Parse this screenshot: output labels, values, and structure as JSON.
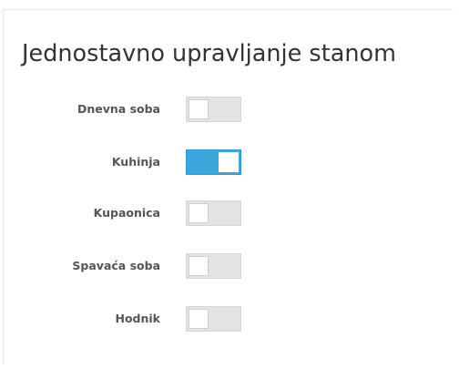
{
  "page": {
    "title": "Jednostavno upravljanje stanom"
  },
  "colors": {
    "toggle_on": "#3aa8dc",
    "toggle_off": "#e3e3e3",
    "title_text": "#333333",
    "label_text": "#555555"
  },
  "rooms": [
    {
      "label": "Dnevna soba",
      "on": false,
      "icon": "toggle-switch"
    },
    {
      "label": "Kuhinja",
      "on": true,
      "icon": "toggle-switch"
    },
    {
      "label": "Kupaonica",
      "on": false,
      "icon": "toggle-switch"
    },
    {
      "label": "Spavaća soba",
      "on": false,
      "icon": "toggle-switch"
    },
    {
      "label": "Hodnik",
      "on": false,
      "icon": "toggle-switch"
    }
  ]
}
